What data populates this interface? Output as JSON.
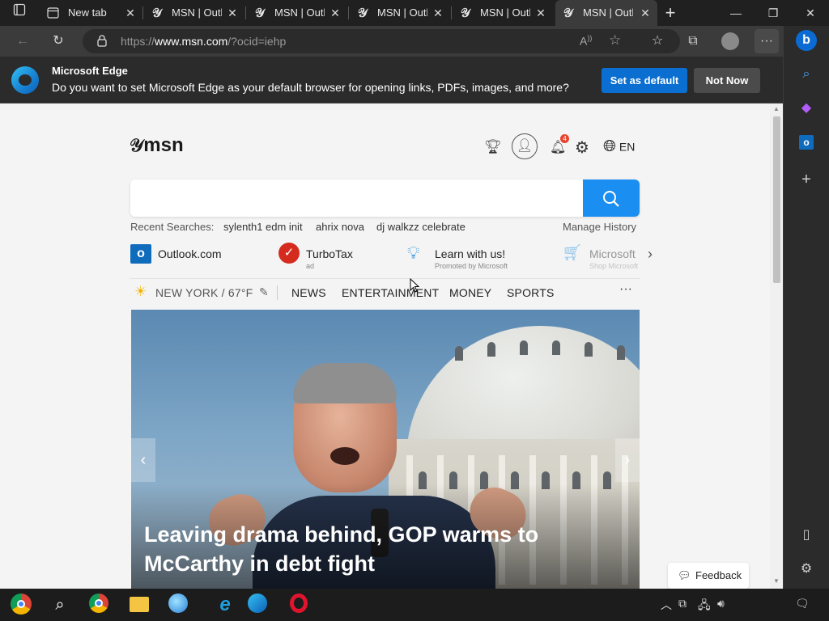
{
  "tabs": [
    {
      "title": "New tab",
      "active": false
    },
    {
      "title": "MSN | Outlo",
      "active": false
    },
    {
      "title": "MSN | Outlo",
      "active": false
    },
    {
      "title": "MSN | Outlo",
      "active": false
    },
    {
      "title": "MSN | Outlo",
      "active": false
    },
    {
      "title": "MSN | Outlo",
      "active": true
    }
  ],
  "address": {
    "prefix": "https://",
    "domain": "www.msn.com",
    "path": "/?ocid=iehp"
  },
  "infobar": {
    "title": "Microsoft Edge",
    "message": "Do you want to set Microsoft Edge as your default browser for opening links, PDFs, images, and more?",
    "primary": "Set as default",
    "secondary": "Not Now"
  },
  "msn": {
    "logo": "msn",
    "notifications": "4",
    "language": "EN",
    "recent_label": "Recent Searches:",
    "recent": [
      "sylenth1 edm init",
      "ahrix nova",
      "dj walkzz celebrate"
    ],
    "manage_history": "Manage History",
    "quick_links": [
      {
        "name": "Outlook.com",
        "sub": ""
      },
      {
        "name": "TurboTax",
        "sub": "ad"
      },
      {
        "name": "Learn with us!",
        "sub": "Promoted by Microsoft"
      },
      {
        "name": "Microsoft",
        "sub": "Shop Microsoft"
      }
    ],
    "weather": "NEW YORK / 67°F",
    "nav": [
      "NEWS",
      "ENTERTAINMENT",
      "MONEY",
      "SPORTS"
    ],
    "headline": "Leaving drama behind, GOP warms to McCarthy in debt fight",
    "feedback": "Feedback"
  },
  "colors": {
    "accent": "#0a6fd0",
    "search_button": "#1b8ef2",
    "notification_badge": "#e8432e"
  }
}
